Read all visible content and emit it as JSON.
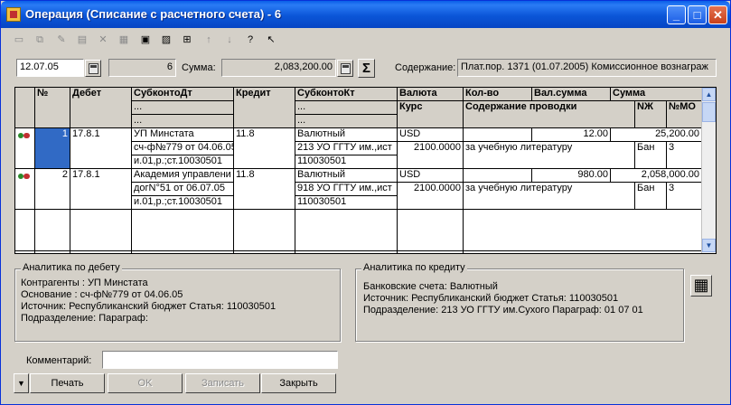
{
  "window": {
    "title": "Операция (Списание с расчетного счета) - 6",
    "minimize": "_",
    "maximize": "□",
    "close": "✕"
  },
  "toolbar": {
    "icons": [
      "new-row-icon",
      "copy-row-icon",
      "edit-row-icon",
      "delete-row-icon",
      "cancel-icon",
      "table-icon",
      "row-select-icon",
      "calc-icon",
      "move-up-icon",
      "move-down-icon",
      "help-icon",
      "context-help-icon"
    ]
  },
  "header": {
    "date": "12.07.05",
    "number": "6",
    "summa_label": "Сумма:",
    "summa_value": "2,083,200.00",
    "sigma": "Σ",
    "content_label": "Содержание:",
    "content_value": "Плат.пор. 1371 (01.07.2005) Комиссионное вознаграж"
  },
  "grid": {
    "headers": {
      "num": "№",
      "debet": "Дебет",
      "subkonto_dt": "СубконтоДт",
      "kredit": "Кредит",
      "subkonto_kt": "СубконтоКт",
      "valuta": "Валюта",
      "kurs": "Курс",
      "kolvo": "Кол-во",
      "val_summa": "Вал.сумма",
      "summa": "Сумма",
      "soderzhanie": "Содержание проводки",
      "nzh": "NЖ",
      "nmo": "№МО",
      "dots": "..."
    },
    "rows": [
      {
        "num": "1",
        "debet": "17.8.1",
        "subkonto_dt": [
          "УП Минстата",
          "сч-ф№779 от 04.06.05",
          "и.01,р.;ст.10030501"
        ],
        "kredit": "11.8",
        "subkonto_kt": [
          "Валютный",
          "213 УО ГГТУ им.,ист",
          "110030501"
        ],
        "valuta": "USD",
        "kurs": "2100.0000",
        "kolvo": "",
        "val_summa": "12.00",
        "summa": "25,200.00",
        "soderzhanie": "за учебную литературу",
        "nzh": "Бан",
        "nmo": "3"
      },
      {
        "num": "2",
        "debet": "17.8.1",
        "subkonto_dt": [
          "Академия управлени",
          "догN°51 от 06.07.05",
          "и.01,р.;ст.10030501"
        ],
        "kredit": "11.8",
        "subkonto_kt": [
          "Валютный",
          "918 УО ГГТУ им.,ист",
          "110030501"
        ],
        "valuta": "USD",
        "kurs": "2100.0000",
        "kolvo": "",
        "val_summa": "980.00",
        "summa": "2,058,000.00",
        "soderzhanie": "за учебную литературу",
        "nzh": "Бан",
        "nmo": "3"
      }
    ]
  },
  "debet_analytics": {
    "title": "Аналитика по дебету",
    "lines": [
      "Контрагенты :  УП Минстата",
      "Основание :  сч-ф№779 от 04.06.05",
      "Источник:  Республиканский бюджет    Статья:  110030501",
      "Подразделение:       Параграф:"
    ]
  },
  "kredit_analytics": {
    "title": "Аналитика по кредиту",
    "lines": [
      "Банковские счета:  Валютный",
      "Источник:  Республиканский бюджет    Статья:  110030501",
      "Подразделение:  213 УО ГГТУ им.Сухого     Параграф:  01 07 01"
    ]
  },
  "footer": {
    "comment_label": "Комментарий:",
    "comment_value": "",
    "menu_arrow": "▼",
    "print": "Печать",
    "ok": "OK",
    "save": "Записать",
    "close": "Закрыть"
  }
}
